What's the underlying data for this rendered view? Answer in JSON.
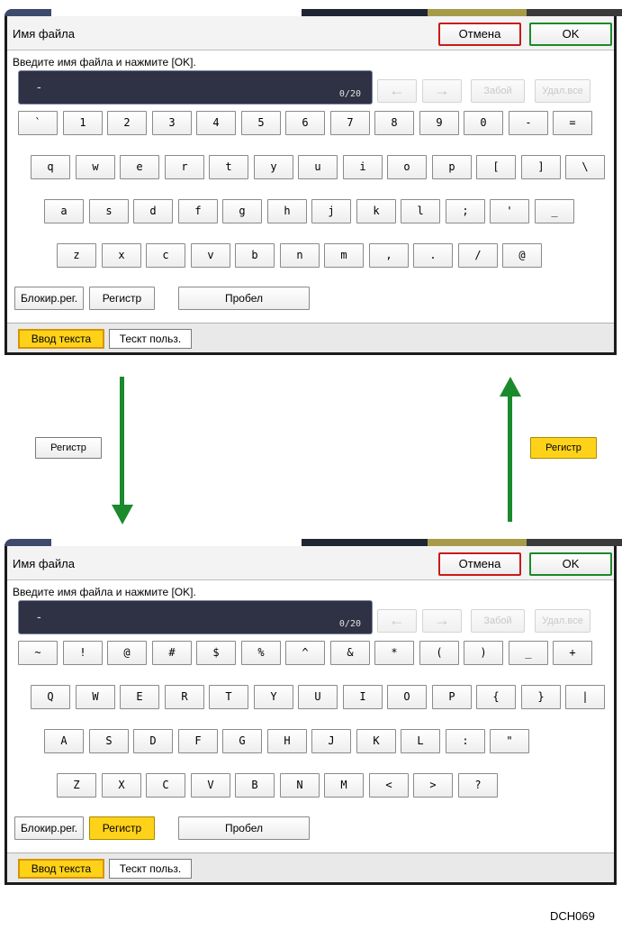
{
  "top_screen": {
    "title": "Имя файла",
    "cancel_label": "Отмена",
    "ok_label": "OK",
    "instruction": "Введите имя файла и нажмите [OK].",
    "input_value": "-",
    "char_counter": "0/20",
    "left_arrow": "←",
    "right_arrow": "→",
    "backspace_label": "Забой",
    "delete_all_label": "Удал.все",
    "keyboard_rows": [
      [
        "`",
        "1",
        "2",
        "3",
        "4",
        "5",
        "6",
        "7",
        "8",
        "9",
        "0",
        "-",
        "="
      ],
      [
        "q",
        "w",
        "e",
        "r",
        "t",
        "y",
        "u",
        "i",
        "o",
        "p",
        "[",
        "]",
        "\\"
      ],
      [
        "a",
        "s",
        "d",
        "f",
        "g",
        "h",
        "j",
        "k",
        "l",
        ";",
        "'",
        "_"
      ],
      [
        "z",
        "x",
        "c",
        "v",
        "b",
        "n",
        "m",
        ",",
        ".",
        "/",
        "@"
      ]
    ],
    "caps_lock_label": "Блокир.рег.",
    "shift_label": "Регистр",
    "space_label": "Пробел",
    "tabs": [
      "Ввод текста",
      "Тескт польз."
    ]
  },
  "middle": {
    "shift_label_left": "Регистр",
    "shift_label_right": "Регистр"
  },
  "bottom_screen": {
    "title": "Имя файла",
    "cancel_label": "Отмена",
    "ok_label": "OK",
    "instruction": "Введите имя файла и нажмите [OK].",
    "input_value": "-",
    "char_counter": "0/20",
    "left_arrow": "←",
    "right_arrow": "→",
    "backspace_label": "Забой",
    "delete_all_label": "Удал.все",
    "keyboard_rows": [
      [
        "~",
        "!",
        "@",
        "#",
        "$",
        "%",
        "^",
        "&",
        "*",
        "(",
        ")",
        "_",
        "+"
      ],
      [
        "Q",
        "W",
        "E",
        "R",
        "T",
        "Y",
        "U",
        "I",
        "O",
        "P",
        "{",
        "}",
        "|"
      ],
      [
        "A",
        "S",
        "D",
        "F",
        "G",
        "H",
        "J",
        "K",
        "L",
        ":",
        "\""
      ],
      [
        "Z",
        "X",
        "C",
        "V",
        "B",
        "N",
        "M",
        "<",
        ">",
        "?"
      ]
    ],
    "caps_lock_label": "Блокир.рег.",
    "shift_label": "Регистр",
    "space_label": "Пробел",
    "tabs": [
      "Ввод текста",
      "Тескт польз."
    ]
  },
  "caption": "DCH069",
  "colors": {
    "accent_yellow": "#ffd21a",
    "cancel_red": "#c91a1a",
    "ok_green": "#1b8a2a",
    "arrow_green": "#1a8a2c",
    "input_bg": "#2f3244"
  }
}
